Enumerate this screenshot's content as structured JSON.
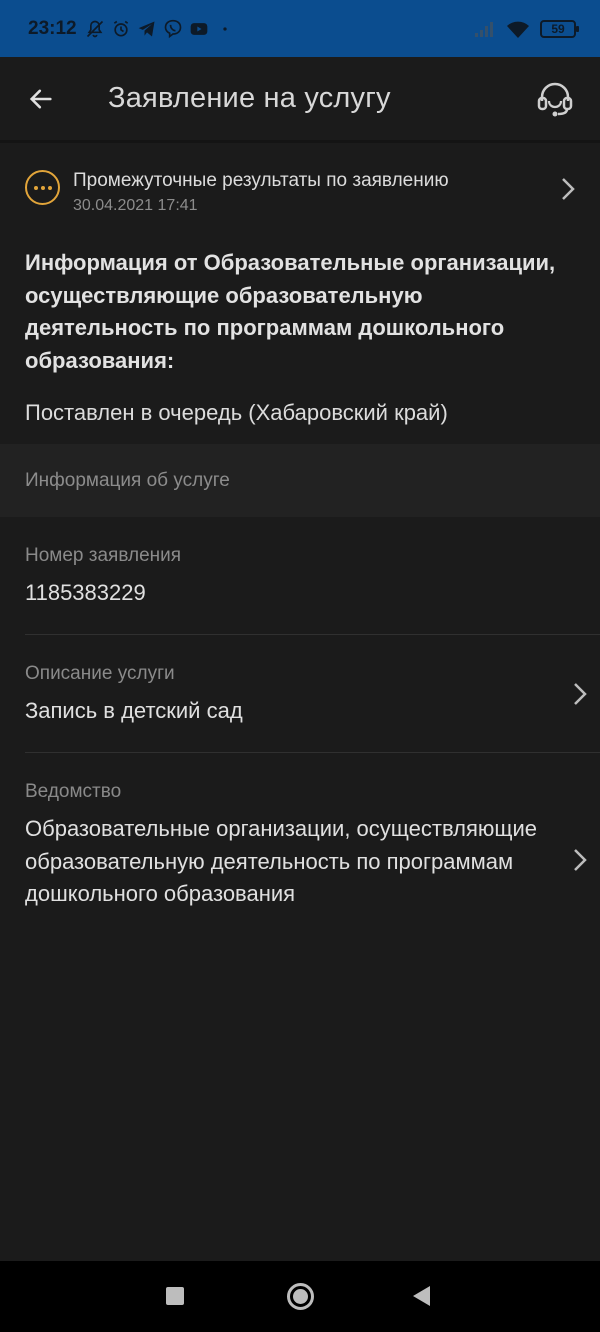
{
  "status_bar": {
    "time": "23:12",
    "battery": "59",
    "icons": [
      "bell-off-icon",
      "alarm-icon",
      "telegram-icon",
      "viber-icon",
      "youtube-icon",
      "dot-icon",
      "signal-icon",
      "wifi-icon",
      "battery-icon"
    ]
  },
  "app_bar": {
    "title": "Заявление на услугу",
    "back_icon": "arrow-left-icon",
    "support_icon": "headset-icon"
  },
  "results": {
    "title": "Промежуточные результаты по заявлению",
    "date": "30.04.2021 17:41",
    "icon_color": "#e2a53a"
  },
  "info": {
    "heading": "Информация от Образовательные организации, осуществляющие образовательную деятельность по программам дошкольного образования:",
    "status": "Поставлен в очередь (Хабаровский край)"
  },
  "service_section": {
    "header": "Информация об услуге",
    "fields": [
      {
        "label": "Номер заявления",
        "value": "1185383229"
      },
      {
        "label": "Описание услуги",
        "value": "Запись в детский сад"
      },
      {
        "label": "Ведомство",
        "value": "Образовательные организации, осуществляющие образовательную деятельность по программам дошкольного образования"
      }
    ]
  },
  "colors": {
    "status_bar": "#0b4d8f",
    "background": "#1b1b1b",
    "accent": "#e2a53a"
  }
}
